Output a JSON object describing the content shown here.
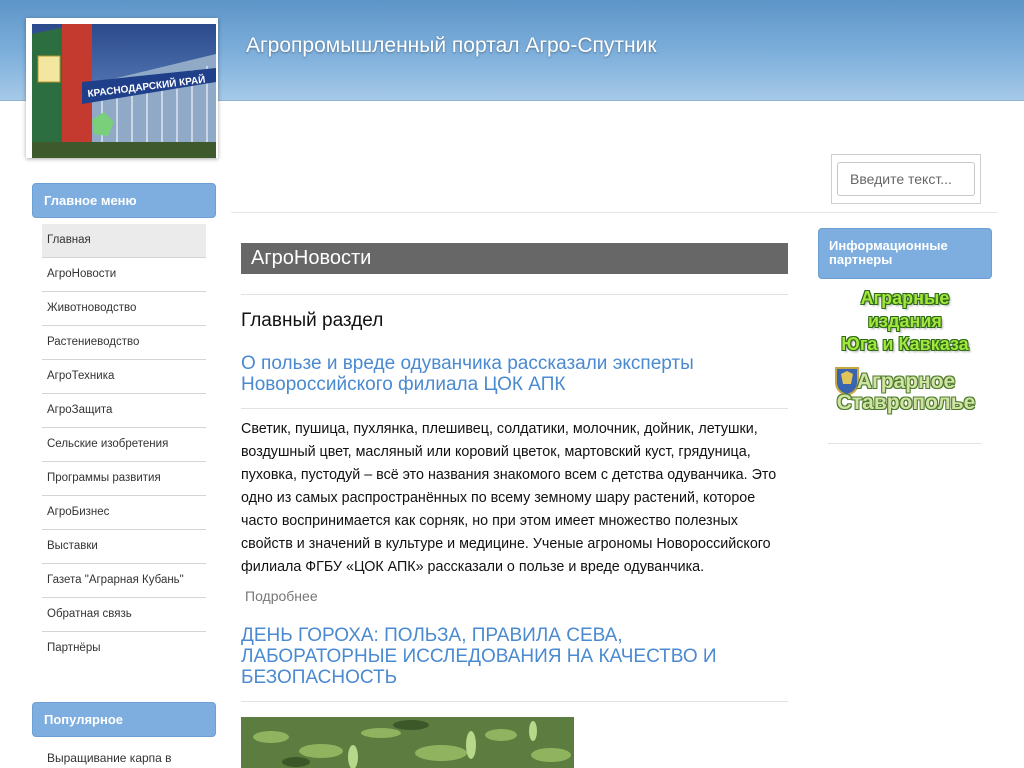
{
  "header": {
    "site_title": "Агропромышленный портал Агро-Спутник",
    "logo_text": "КРАСНОДАРСКИЙ КРАЙ"
  },
  "search": {
    "placeholder": "Введите текст..."
  },
  "main_menu": {
    "title": "Главное меню",
    "items": [
      {
        "label": "Главная",
        "active": true
      },
      {
        "label": "АгроНовости"
      },
      {
        "label": "Животноводство"
      },
      {
        "label": "Растениеводство"
      },
      {
        "label": "АгроТехника"
      },
      {
        "label": "АгроЗащита"
      },
      {
        "label": "Сельские изобретения"
      },
      {
        "label": "Программы развития"
      },
      {
        "label": "АгроБизнес"
      },
      {
        "label": "Выставки"
      },
      {
        "label": "Газета \"Аграрная Кубань\""
      },
      {
        "label": "Обратная связь"
      },
      {
        "label": "Партнёры"
      }
    ]
  },
  "popular": {
    "title": "Популярное",
    "items": [
      {
        "label": "Выращивание карпа в"
      }
    ]
  },
  "content": {
    "section_title": "АгроНовости",
    "main_heading": "Главный раздел",
    "articles": [
      {
        "title": "О пользе и вреде одуванчика рассказали эксперты Новороссийского филиала ЦОК АПК",
        "body": "Светик, пушица, пухлянка, плешивец, солдатики, молочник, дойник, летушки, воздушный цвет, масляный или коровий цветок, мартовский куст, грядуница, пуховка, пустодуй – всё это названия знакомого всем с детства одуванчика. Это одно из самых распространённых по всему земному шару растений, которое часто воспринимается как сорняк, но при этом имеет множество полезных свойств и значений в культуре и медицине. Ученые агрономы Новороссийского филиала ФГБУ «ЦОК АПК» рассказали о пользе и вреде одуванчика.",
        "more_label": "Подробнее"
      },
      {
        "title": "ДЕНЬ ГОРОХА: ПОЛЬЗА, ПРАВИЛА СЕВА, ЛАБОРАТОРНЫЕ ИССЛЕДОВАНИЯ НА КАЧЕСТВО И БЕЗОПАСНОСТЬ"
      }
    ]
  },
  "partners": {
    "title": "Информационные партнеры",
    "banner1_lines": [
      "Аграрные",
      "издания",
      "Юга и Кавказа"
    ],
    "banner2_lines": [
      "Аграрное",
      "Ставрополье"
    ]
  },
  "colors": {
    "accent": "#7eaee0",
    "link": "#4a8ad0",
    "section_bar": "#676767"
  }
}
